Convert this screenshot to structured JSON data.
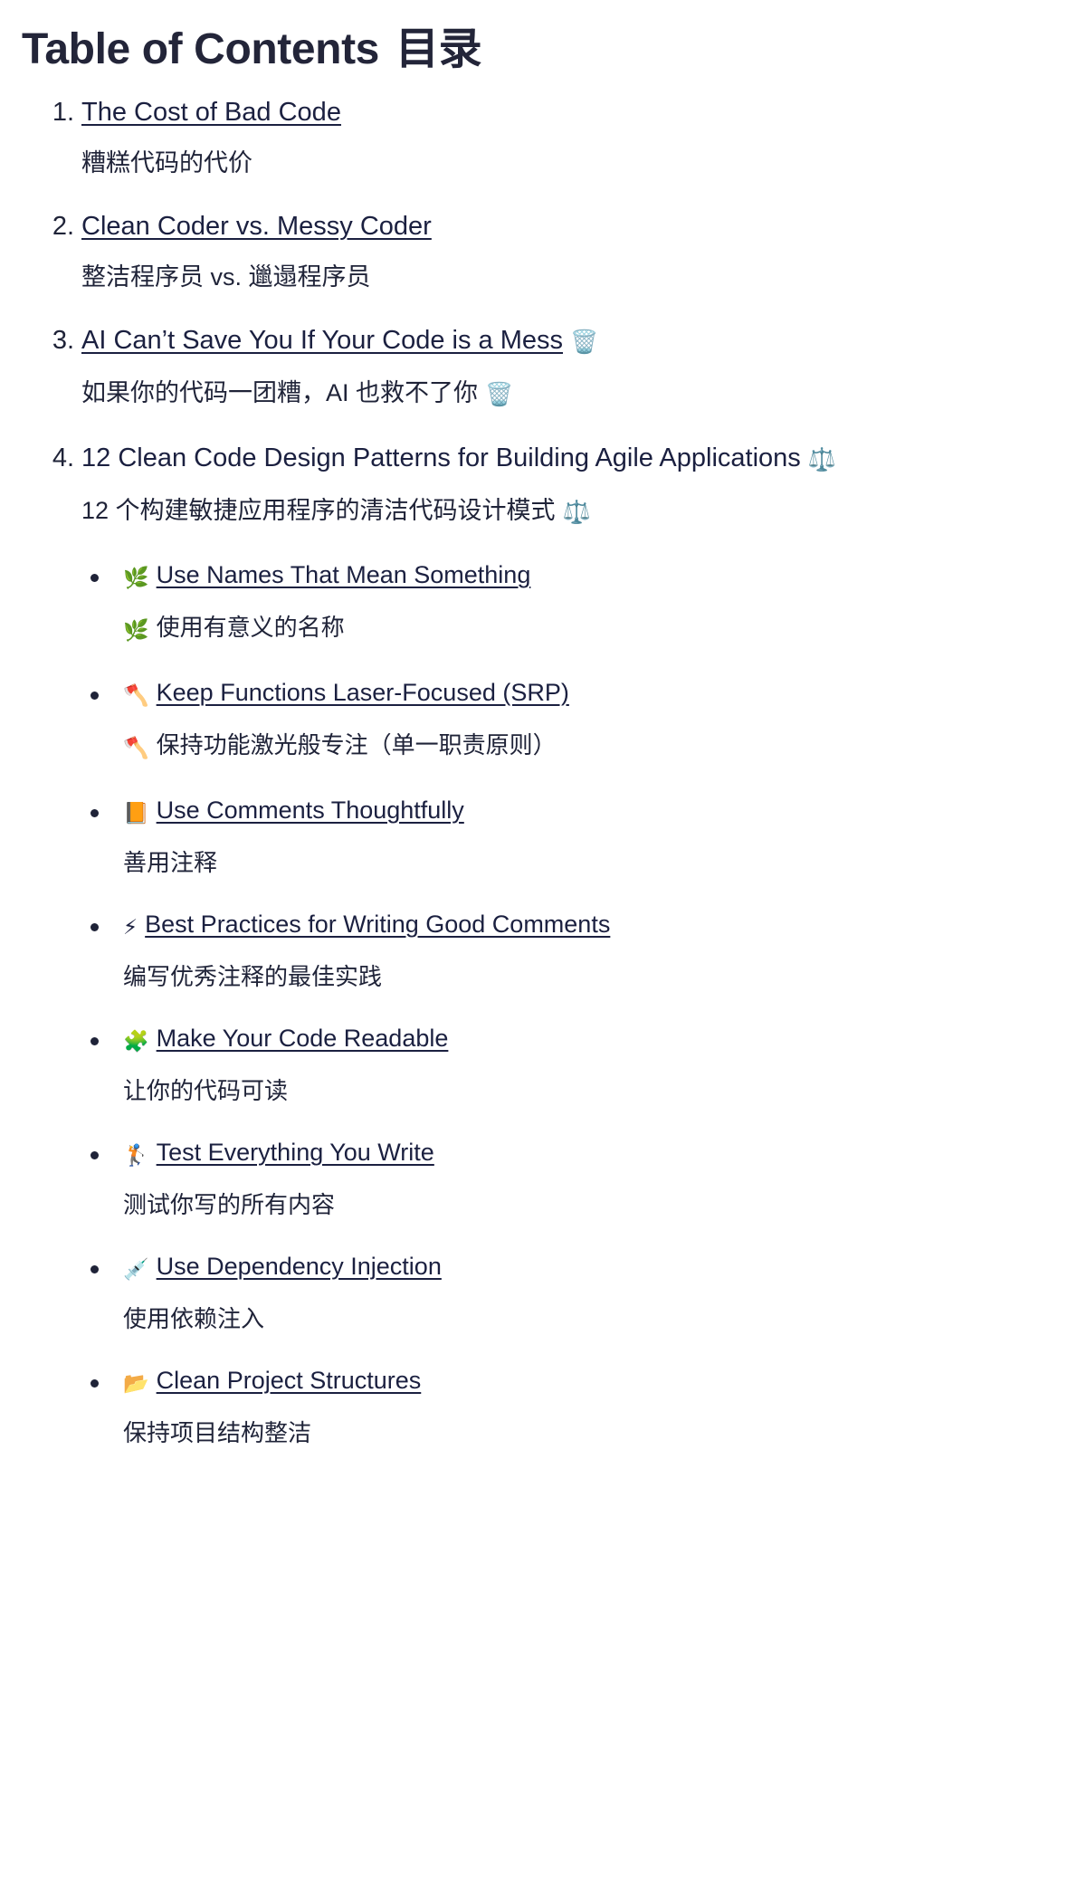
{
  "document": {
    "title_en": "Table of Contents",
    "title_cn": "目录"
  },
  "toc": {
    "items": [
      {
        "number": "1.",
        "en": "The Cost of Bad Code",
        "en_emoji": "",
        "cn": "糟糕代码的代价",
        "cn_emoji": "",
        "is_link": true
      },
      {
        "number": "2.",
        "en": "Clean Coder vs. Messy Coder",
        "en_emoji": "",
        "cn": "整洁程序员 vs. 邋遢程序员",
        "cn_emoji": "",
        "is_link": true
      },
      {
        "number": "3.",
        "en": "AI Can’t Save You If Your Code is a Mess",
        "en_emoji": "🗑️",
        "cn": "如果你的代码一团糟，AI 也救不了你",
        "cn_emoji": "🗑️",
        "is_link": true
      },
      {
        "number": "4.",
        "en": "12 Clean Code Design Patterns for Building Agile Applications",
        "en_emoji": "⚖️",
        "cn": "12 个构建敏捷应用程序的清洁代码设计模式",
        "cn_emoji": "⚖️",
        "is_link": false
      }
    ],
    "subitems": [
      {
        "en_emoji": "🌿",
        "en": "Use Names That Mean Something",
        "cn_emoji": "🌿",
        "cn": "使用有意义的名称"
      },
      {
        "en_emoji": "🪓",
        "en": "Keep Functions Laser-Focused (SRP)",
        "cn_emoji": "🪓",
        "cn": "保持功能激光般专注（单一职责原则）"
      },
      {
        "en_emoji": "📙",
        "en": "Use Comments Thoughtfully",
        "cn_emoji": "",
        "cn": "善用注释"
      },
      {
        "en_emoji": "⚡",
        "en": "Best Practices for Writing Good Comments",
        "cn_emoji": "",
        "cn": "编写优秀注释的最佳实践"
      },
      {
        "en_emoji": "🧩",
        "en": "Make Your Code Readable",
        "cn_emoji": "",
        "cn": "让你的代码可读"
      },
      {
        "en_emoji": "🏌️",
        "en": "Test Everything You Write",
        "cn_emoji": "",
        "cn": "测试你写的所有内容"
      },
      {
        "en_emoji": "💉",
        "en": "Use Dependency Injection",
        "cn_emoji": "",
        "cn": "使用依赖注入"
      },
      {
        "en_emoji": "📂",
        "en": "Clean Project Structures",
        "cn_emoji": "",
        "cn": "保持项目结构整洁"
      }
    ]
  },
  "colors": {
    "title": "#232539",
    "body": "#1f2338",
    "link": "#1b2040",
    "background": "#ffffff"
  }
}
